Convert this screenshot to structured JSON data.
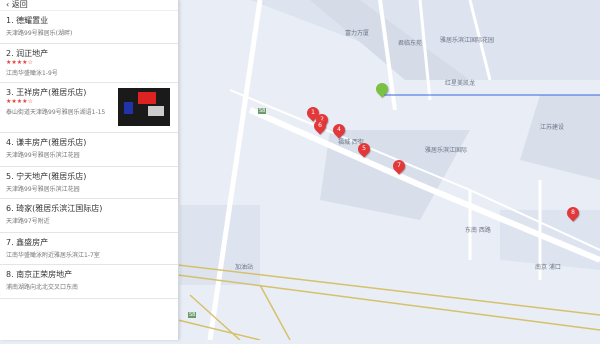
{
  "panel": {
    "back_label": "返回",
    "items": [
      {
        "title": "1. 德耀置业",
        "sub": "天津路99号雅居乐(湖畔)"
      },
      {
        "title": "2. 润正地产",
        "sub": "江南华盛瞰泳1-9号",
        "stars": "★★★★☆"
      },
      {
        "title": "3. 王祥房产(雅居乐店)",
        "sub": "泰山街道天津路99号雅居乐湖语1-15",
        "stars": "★★★★☆"
      },
      {
        "title": "4. 谦丰房产(雅居乐店)",
        "sub": "天津路99号雅居乐滨江花园"
      },
      {
        "title": "5. 宁天地产(雅居乐店)",
        "sub": "天津路99号雅居乐滨江花园"
      },
      {
        "title": "6. 琦家(雅居乐滨江国际店)",
        "sub": "天津路97号附近"
      },
      {
        "title": "7. 鑫盛房产",
        "sub": "江南华盛瞰泳附近雅居乐滨江1-7室"
      },
      {
        "title": "8. 南京正荣房地产",
        "sub": "浦南湖路向北北交叉口东南"
      }
    ]
  },
  "map": {
    "labels": [
      {
        "text": "富力万厦",
        "name": "map-label-fuli"
      },
      {
        "text": "君临东苑",
        "name": "map-label-junlin"
      },
      {
        "text": "雅居乐滨江国际花园",
        "name": "map-label-yajule-binjiang"
      },
      {
        "text": "红星美凯龙",
        "name": "map-label-hongxing"
      },
      {
        "text": "雅居乐滨江国际",
        "name": "map-label-yajule-guoji"
      },
      {
        "text": "江苏建设",
        "name": "map-label-jiangsu"
      },
      {
        "text": "福城 西街",
        "name": "map-label-fucheng"
      },
      {
        "text": "加油站",
        "name": "map-label-gas"
      },
      {
        "text": "东南 西路",
        "name": "map-label-dongnan"
      },
      {
        "text": "南京 浦口",
        "name": "map-label-nanjing"
      }
    ],
    "markers": [
      "1",
      "2",
      "4",
      "5",
      "6",
      "7",
      "8"
    ],
    "roads": [
      "S8",
      "S8"
    ],
    "colors": {
      "marker": "#e3383a",
      "current": "#7ac143",
      "route": "#3366dd"
    }
  }
}
